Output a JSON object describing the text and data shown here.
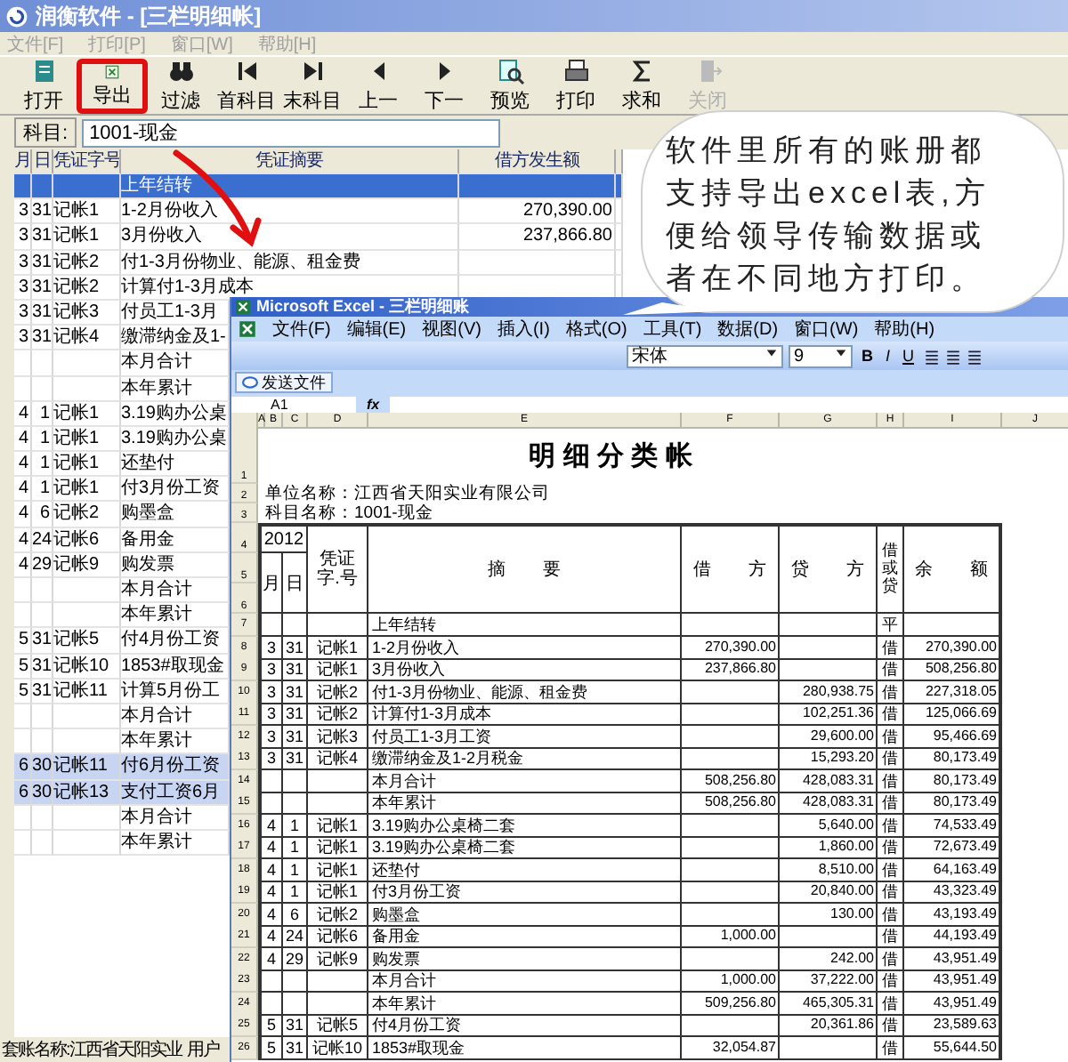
{
  "app": {
    "title": "润衡软件 - [三栏明细帐]",
    "menu": [
      "文件[F]",
      "打印[P]",
      "窗口[W]",
      "帮助[H]"
    ],
    "toolbar": [
      {
        "label": "打开",
        "kind": "open",
        "disabled": false
      },
      {
        "label": "导出",
        "kind": "export",
        "disabled": false,
        "highlighted": true
      },
      {
        "label": "过滤",
        "kind": "filter",
        "disabled": false
      },
      {
        "label": "首科目",
        "kind": "first",
        "disabled": false
      },
      {
        "label": "末科目",
        "kind": "last",
        "disabled": false
      },
      {
        "label": "上一",
        "kind": "prev",
        "disabled": false
      },
      {
        "label": "下一",
        "kind": "next",
        "disabled": false
      },
      {
        "label": "预览",
        "kind": "preview",
        "disabled": false
      },
      {
        "label": "打印",
        "kind": "print",
        "disabled": false
      },
      {
        "label": "求和",
        "kind": "sum",
        "disabled": false
      },
      {
        "label": "关闭",
        "kind": "close",
        "disabled": true
      }
    ],
    "subject": {
      "label": "科目:",
      "value": "1001-现金"
    },
    "columns": [
      "月",
      "日",
      "凭证字号",
      "凭证摘要",
      "借方发生额"
    ],
    "rows": [
      {
        "summary": "上年结转",
        "selected": true,
        "marked": false
      },
      {
        "month": "3",
        "day": "31",
        "voucher": "记帐1",
        "summary": "1-2月份收入",
        "debit": "270,390.00",
        "selected": false,
        "marked": false
      },
      {
        "month": "3",
        "day": "31",
        "voucher": "记帐1",
        "summary": "3月份收入",
        "debit": "237,866.80",
        "selected": false,
        "marked": false
      },
      {
        "month": "3",
        "day": "31",
        "voucher": "记帐2",
        "summary": "付1-3月份物业、能源、租金费",
        "selected": false,
        "marked": false
      },
      {
        "month": "3",
        "day": "31",
        "voucher": "记帐2",
        "summary": "计算付1-3月成本",
        "selected": false,
        "marked": false
      },
      {
        "month": "3",
        "day": "31",
        "voucher": "记帐3",
        "summary": "付员工1-3月",
        "selected": false,
        "marked": false
      },
      {
        "month": "3",
        "day": "31",
        "voucher": "记帐4",
        "summary": "缴滞纳金及1-",
        "selected": false,
        "marked": false
      },
      {
        "summary": "本月合计",
        "selected": false,
        "marked": false
      },
      {
        "summary": "本年累计",
        "selected": false,
        "marked": false
      },
      {
        "month": "4",
        "day": "1",
        "voucher": "记帐1",
        "summary": "3.19购办公桌",
        "selected": false,
        "marked": false
      },
      {
        "month": "4",
        "day": "1",
        "voucher": "记帐1",
        "summary": "3.19购办公桌",
        "selected": false,
        "marked": false
      },
      {
        "month": "4",
        "day": "1",
        "voucher": "记帐1",
        "summary": "还垫付",
        "selected": false,
        "marked": false
      },
      {
        "month": "4",
        "day": "1",
        "voucher": "记帐1",
        "summary": "付3月份工资",
        "selected": false,
        "marked": false
      },
      {
        "month": "4",
        "day": "6",
        "voucher": "记帐2",
        "summary": "购墨盒",
        "selected": false,
        "marked": false
      },
      {
        "month": "4",
        "day": "24",
        "voucher": "记帐6",
        "summary": "备用金",
        "selected": false,
        "marked": false
      },
      {
        "month": "4",
        "day": "29",
        "voucher": "记帐9",
        "summary": "购发票",
        "selected": false,
        "marked": false
      },
      {
        "summary": "本月合计",
        "selected": false,
        "marked": false
      },
      {
        "summary": "本年累计",
        "selected": false,
        "marked": false
      },
      {
        "month": "5",
        "day": "31",
        "voucher": "记帐5",
        "summary": "付4月份工资",
        "selected": false,
        "marked": false
      },
      {
        "month": "5",
        "day": "31",
        "voucher": "记帐10",
        "summary": "1853#取现金",
        "selected": false,
        "marked": false
      },
      {
        "month": "5",
        "day": "31",
        "voucher": "记帐11",
        "summary": "计算5月份工",
        "selected": false,
        "marked": false
      },
      {
        "summary": "本月合计",
        "selected": false,
        "marked": false
      },
      {
        "summary": "本年累计",
        "selected": false,
        "marked": false
      },
      {
        "month": "6",
        "day": "30",
        "voucher": "记帐11",
        "summary": "付6月份工资",
        "selected": false,
        "marked": true
      },
      {
        "month": "6",
        "day": "30",
        "voucher": "记帐13",
        "summary": "支付工资6月",
        "selected": false,
        "marked": true
      },
      {
        "summary": "本月合计",
        "selected": false,
        "marked": false
      },
      {
        "summary": "本年累计",
        "selected": false,
        "marked": false
      }
    ],
    "status": [
      "套账名称:江西省天阳实业",
      "用户"
    ]
  },
  "excel": {
    "title": "Microsoft Excel - 三栏明细账",
    "menu": [
      "文件(F)",
      "编辑(E)",
      "视图(V)",
      "插入(I)",
      "格式(O)",
      "工具(T)",
      "数据(D)",
      "窗口(W)",
      "帮助(H)"
    ],
    "font": "宋体",
    "font_size": "9",
    "format_buttons": [
      "B",
      "I",
      "U"
    ],
    "send_button": "发送文件",
    "name_box": "A1",
    "fx": "fx",
    "column_letters": [
      "A",
      "B",
      "C",
      "D",
      "E",
      "F",
      "G",
      "H",
      "I",
      "J"
    ],
    "row_numbers": [
      "1",
      "2",
      "3",
      "4",
      "5",
      "6",
      "7",
      "8",
      "9",
      "10",
      "11",
      "12",
      "13",
      "14",
      "15",
      "16",
      "17",
      "18",
      "19",
      "20",
      "21",
      "22",
      "23",
      "24",
      "25",
      "26"
    ],
    "sheet_title": "明 细 分 类 帐",
    "unit": "单位名称：江西省天阳实业有限公司",
    "subject": "科目名称：1001-现金",
    "header": {
      "year": "2012",
      "month": "月",
      "day": "日",
      "voucher": "凭证字.号",
      "summary": "摘 要",
      "debit": "借 方",
      "credit": "贷 方",
      "dc": "借或贷",
      "balance": "余 额"
    },
    "rows": [
      {
        "summary": "上年结转",
        "dc": "平"
      },
      {
        "month": "3",
        "day": "31",
        "voucher": "记帐1",
        "summary": "1-2月份收入",
        "debit": "270,390.00",
        "dc": "借",
        "balance": "270,390.00"
      },
      {
        "month": "3",
        "day": "31",
        "voucher": "记帐1",
        "summary": "3月份收入",
        "debit": "237,866.80",
        "dc": "借",
        "balance": "508,256.80"
      },
      {
        "month": "3",
        "day": "31",
        "voucher": "记帐2",
        "summary": "付1-3月份物业、能源、租金费",
        "credit": "280,938.75",
        "dc": "借",
        "balance": "227,318.05"
      },
      {
        "month": "3",
        "day": "31",
        "voucher": "记帐2",
        "summary": "计算付1-3月成本",
        "credit": "102,251.36",
        "dc": "借",
        "balance": "125,066.69"
      },
      {
        "month": "3",
        "day": "31",
        "voucher": "记帐3",
        "summary": "付员工1-3月工资",
        "credit": "29,600.00",
        "dc": "借",
        "balance": "95,466.69"
      },
      {
        "month": "3",
        "day": "31",
        "voucher": "记帐4",
        "summary": "缴滞纳金及1-2月税金",
        "credit": "15,293.20",
        "dc": "借",
        "balance": "80,173.49"
      },
      {
        "summary": "本月合计",
        "debit": "508,256.80",
        "credit": "428,083.31",
        "dc": "借",
        "balance": "80,173.49"
      },
      {
        "summary": "本年累计",
        "debit": "508,256.80",
        "credit": "428,083.31",
        "dc": "借",
        "balance": "80,173.49"
      },
      {
        "month": "4",
        "day": "1",
        "voucher": "记帐1",
        "summary": "3.19购办公桌椅二套",
        "credit": "5,640.00",
        "dc": "借",
        "balance": "74,533.49"
      },
      {
        "month": "4",
        "day": "1",
        "voucher": "记帐1",
        "summary": "3.19购办公桌椅二套",
        "credit": "1,860.00",
        "dc": "借",
        "balance": "72,673.49"
      },
      {
        "month": "4",
        "day": "1",
        "voucher": "记帐1",
        "summary": "还垫付",
        "credit": "8,510.00",
        "dc": "借",
        "balance": "64,163.49"
      },
      {
        "month": "4",
        "day": "1",
        "voucher": "记帐1",
        "summary": "付3月份工资",
        "credit": "20,840.00",
        "dc": "借",
        "balance": "43,323.49"
      },
      {
        "month": "4",
        "day": "6",
        "voucher": "记帐2",
        "summary": "购墨盒",
        "credit": "130.00",
        "dc": "借",
        "balance": "43,193.49"
      },
      {
        "month": "4",
        "day": "24",
        "voucher": "记帐6",
        "summary": "备用金",
        "debit": "1,000.00",
        "dc": "借",
        "balance": "44,193.49"
      },
      {
        "month": "4",
        "day": "29",
        "voucher": "记帐9",
        "summary": "购发票",
        "credit": "242.00",
        "dc": "借",
        "balance": "43,951.49"
      },
      {
        "summary": "本月合计",
        "debit": "1,000.00",
        "credit": "37,222.00",
        "dc": "借",
        "balance": "43,951.49"
      },
      {
        "summary": "本年累计",
        "debit": "509,256.80",
        "credit": "465,305.31",
        "dc": "借",
        "balance": "43,951.49"
      },
      {
        "month": "5",
        "day": "31",
        "voucher": "记帐5",
        "summary": "付4月份工资",
        "credit": "20,361.86",
        "dc": "借",
        "balance": "23,589.63"
      },
      {
        "month": "5",
        "day": "31",
        "voucher": "记帐10",
        "summary": "1853#取现金",
        "debit": "32,054.87",
        "dc": "借",
        "balance": "55,644.50"
      }
    ]
  },
  "callout": {
    "text": "软件里所有的账册都支持导出excel表,方便给领导传输数据或者在不同地方打印。"
  }
}
